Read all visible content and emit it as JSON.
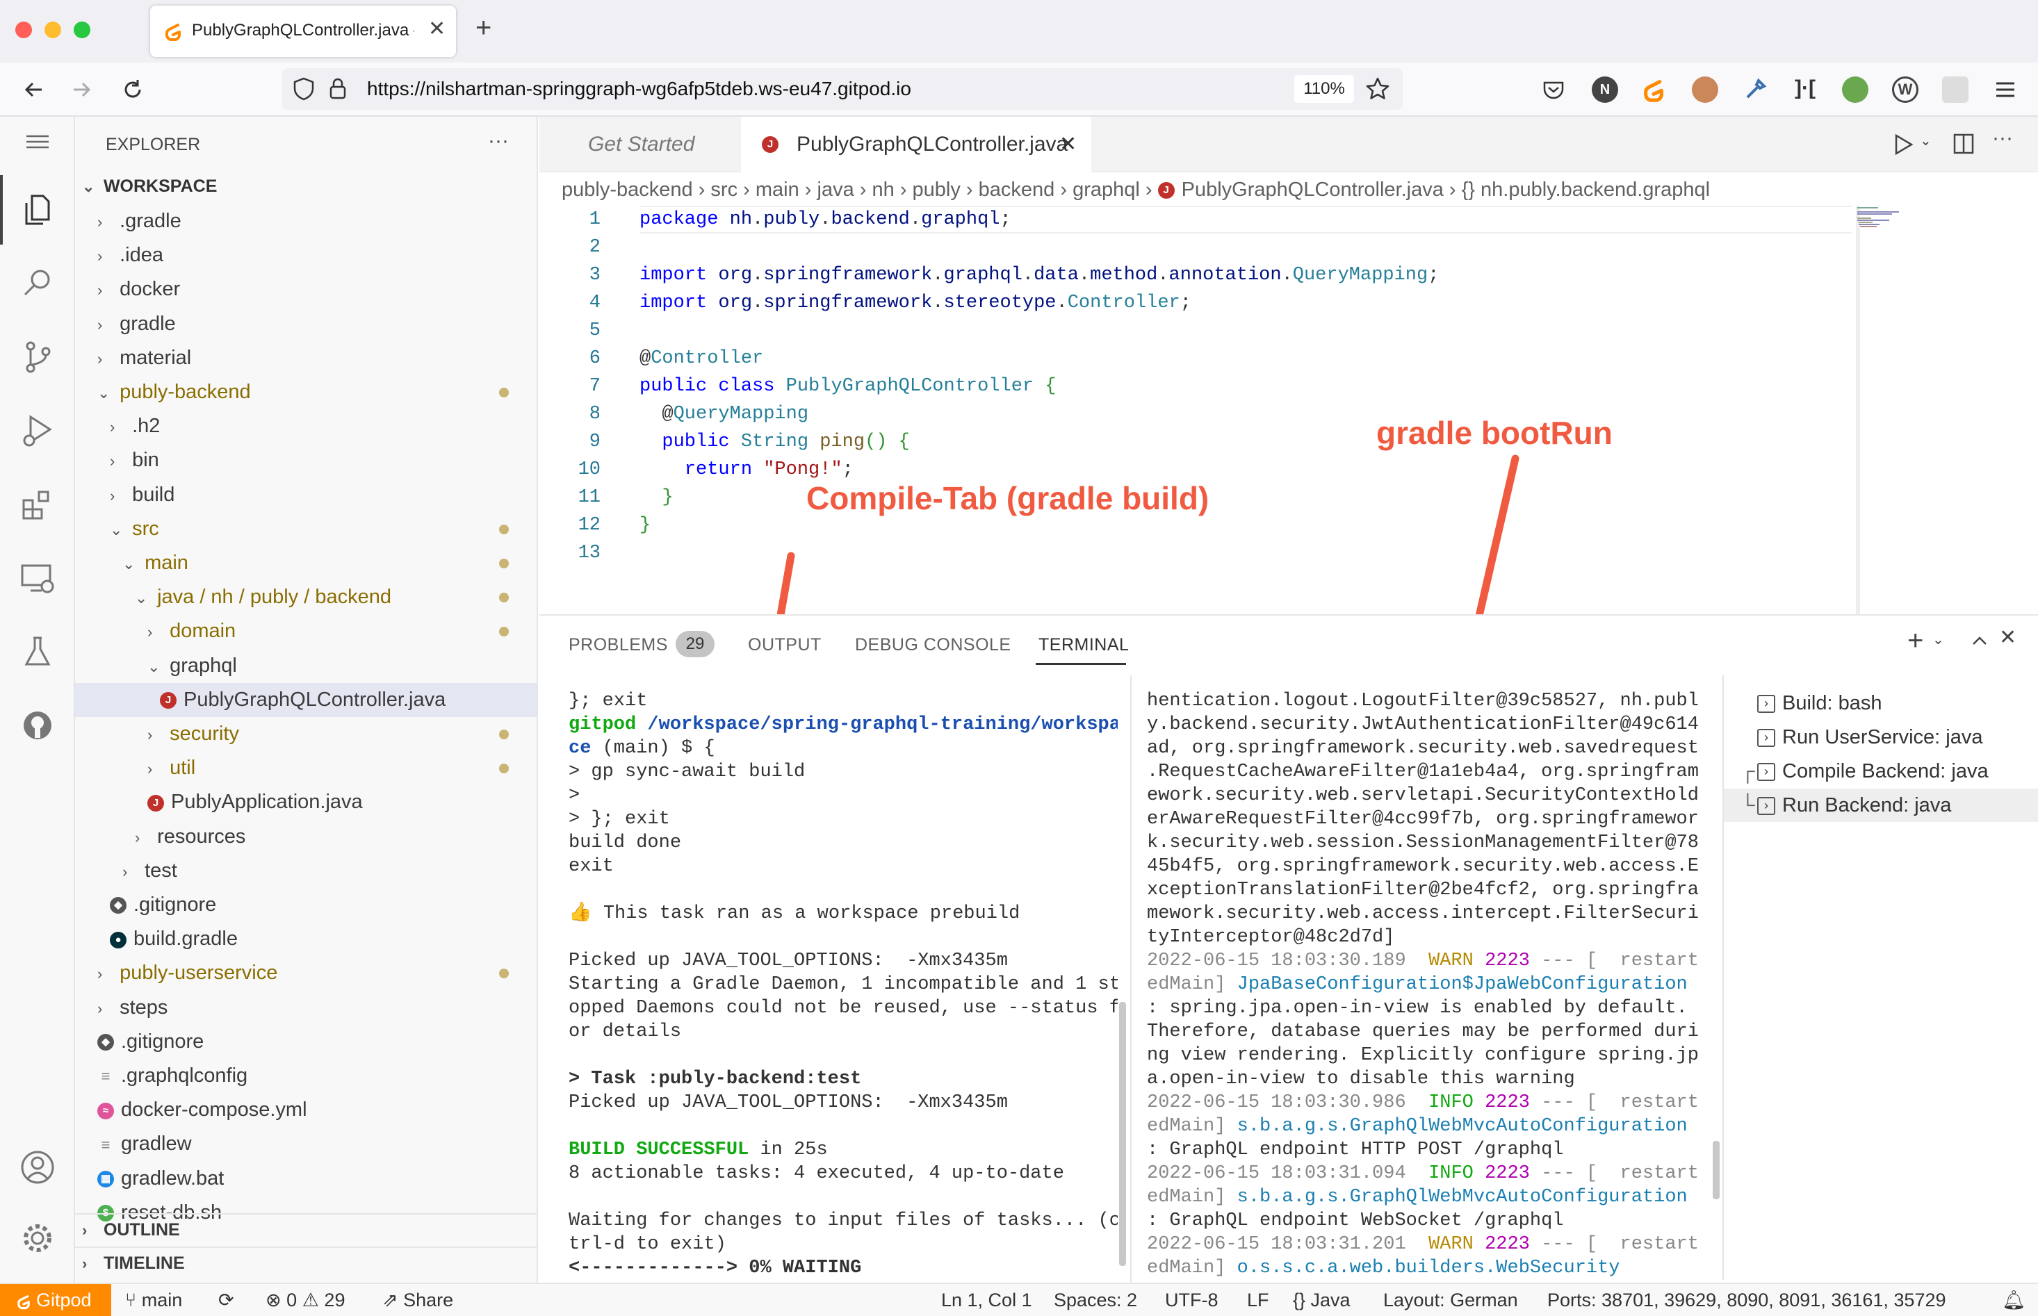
{
  "browser": {
    "tab_title": "PublyGraphQLController.java —",
    "url": "https://nilshartman-springgraph-wg6afp5tdeb.ws-eu47.gitpod.io",
    "zoom": "110%",
    "colors": {
      "close": "#ff5f57",
      "minimize": "#febc2e",
      "maximize": "#28c840"
    }
  },
  "explorer": {
    "title": "EXPLORER",
    "workspace": "WORKSPACE",
    "items": [
      {
        "label": ".gradle",
        "indent": 1,
        "kind": "folder",
        "open": false
      },
      {
        "label": ".idea",
        "indent": 1,
        "kind": "folder",
        "open": false
      },
      {
        "label": "docker",
        "indent": 1,
        "kind": "folder",
        "open": false
      },
      {
        "label": "gradle",
        "indent": 1,
        "kind": "folder",
        "open": false
      },
      {
        "label": "material",
        "indent": 1,
        "kind": "folder",
        "open": false
      },
      {
        "label": "publy-backend",
        "indent": 1,
        "kind": "folder",
        "open": true,
        "modified": true
      },
      {
        "label": ".h2",
        "indent": 2,
        "kind": "folder",
        "open": false
      },
      {
        "label": "bin",
        "indent": 2,
        "kind": "folder",
        "open": false
      },
      {
        "label": "build",
        "indent": 2,
        "kind": "folder",
        "open": false
      },
      {
        "label": "src",
        "indent": 2,
        "kind": "folder",
        "open": true,
        "modified": true
      },
      {
        "label": "main",
        "indent": 3,
        "kind": "folder",
        "open": true,
        "modified": true
      },
      {
        "label": "java / nh / publy / backend",
        "indent": 4,
        "kind": "folder",
        "open": true,
        "modified": true
      },
      {
        "label": "domain",
        "indent": 5,
        "kind": "folder",
        "open": false,
        "modified": true
      },
      {
        "label": "graphql",
        "indent": 5,
        "kind": "folder",
        "open": true
      },
      {
        "label": "PublyGraphQLController.java",
        "indent": 6,
        "kind": "java",
        "selected": true
      },
      {
        "label": "security",
        "indent": 5,
        "kind": "folder",
        "open": false,
        "modified": true
      },
      {
        "label": "util",
        "indent": 5,
        "kind": "folder",
        "open": false,
        "modified": true
      },
      {
        "label": "PublyApplication.java",
        "indent": 5,
        "kind": "java"
      },
      {
        "label": "resources",
        "indent": 4,
        "kind": "folder",
        "open": false
      },
      {
        "label": "test",
        "indent": 3,
        "kind": "folder",
        "open": false
      },
      {
        "label": ".gitignore",
        "indent": 2,
        "kind": "git"
      },
      {
        "label": "build.gradle",
        "indent": 2,
        "kind": "gradle"
      },
      {
        "label": "publy-userservice",
        "indent": 1,
        "kind": "folder",
        "open": false,
        "modified": true
      },
      {
        "label": "steps",
        "indent": 1,
        "kind": "folder",
        "open": false
      },
      {
        "label": ".gitignore",
        "indent": 1,
        "kind": "git"
      },
      {
        "label": ".graphqlconfig",
        "indent": 1,
        "kind": "text"
      },
      {
        "label": "docker-compose.yml",
        "indent": 1,
        "kind": "docker"
      },
      {
        "label": "gradlew",
        "indent": 1,
        "kind": "text"
      },
      {
        "label": "gradlew.bat",
        "indent": 1,
        "kind": "windows"
      },
      {
        "label": "reset-db.sh",
        "indent": 1,
        "kind": "shell"
      }
    ],
    "outline": "OUTLINE",
    "timeline": "TIMELINE"
  },
  "editor": {
    "tabs": [
      {
        "label": "Get Started",
        "active": false
      },
      {
        "label": "PublyGraphQLController.java",
        "active": true
      }
    ],
    "breadcrumb": [
      "publy-backend",
      "src",
      "main",
      "java",
      "nh",
      "publy",
      "backend",
      "graphql",
      "PublyGraphQLController.java",
      "{} nh.publy.backend.graphql"
    ],
    "lines": [
      [
        {
          "t": "package ",
          "c": "kw"
        },
        {
          "t": "nh",
          "c": "pk"
        },
        {
          "t": ".",
          "c": ""
        },
        {
          "t": "publy",
          "c": "pk"
        },
        {
          "t": ".",
          "c": ""
        },
        {
          "t": "backend",
          "c": "pk"
        },
        {
          "t": ".",
          "c": ""
        },
        {
          "t": "graphql",
          "c": "pk"
        },
        {
          "t": ";",
          "c": ""
        }
      ],
      [],
      [
        {
          "t": "import ",
          "c": "kw"
        },
        {
          "t": "org",
          "c": "pk"
        },
        {
          "t": ".",
          "c": ""
        },
        {
          "t": "springframework",
          "c": "pk"
        },
        {
          "t": ".",
          "c": ""
        },
        {
          "t": "graphql",
          "c": "pk"
        },
        {
          "t": ".",
          "c": ""
        },
        {
          "t": "data",
          "c": "pk"
        },
        {
          "t": ".",
          "c": ""
        },
        {
          "t": "method",
          "c": "pk"
        },
        {
          "t": ".",
          "c": ""
        },
        {
          "t": "annotation",
          "c": "pk"
        },
        {
          "t": ".",
          "c": ""
        },
        {
          "t": "QueryMapping",
          "c": "ty"
        },
        {
          "t": ";",
          "c": ""
        }
      ],
      [
        {
          "t": "import ",
          "c": "kw"
        },
        {
          "t": "org",
          "c": "pk"
        },
        {
          "t": ".",
          "c": ""
        },
        {
          "t": "springframework",
          "c": "pk"
        },
        {
          "t": ".",
          "c": ""
        },
        {
          "t": "stereotype",
          "c": "pk"
        },
        {
          "t": ".",
          "c": ""
        },
        {
          "t": "Controller",
          "c": "ty"
        },
        {
          "t": ";",
          "c": ""
        }
      ],
      [],
      [
        {
          "t": "@",
          "c": ""
        },
        {
          "t": "Controller",
          "c": "ty"
        }
      ],
      [
        {
          "t": "public class ",
          "c": "kw"
        },
        {
          "t": "PublyGraphQLController",
          "c": "ty"
        },
        {
          "t": " {",
          "c": "br"
        }
      ],
      [
        {
          "t": "  @",
          "c": ""
        },
        {
          "t": "QueryMapping",
          "c": "ty"
        }
      ],
      [
        {
          "t": "  public ",
          "c": "kw"
        },
        {
          "t": "String ",
          "c": "ty"
        },
        {
          "t": "ping",
          "c": "fn"
        },
        {
          "t": "() {",
          "c": "br"
        }
      ],
      [
        {
          "t": "    return ",
          "c": "kw"
        },
        {
          "t": "\"Pong!\"",
          "c": "st"
        },
        {
          "t": ";",
          "c": ""
        }
      ],
      [
        {
          "t": "  }",
          "c": "br"
        }
      ],
      [
        {
          "t": "}",
          "c": "br"
        }
      ],
      []
    ]
  },
  "annotations": {
    "compile": "Compile-Tab (gradle build)",
    "bootrun": "gradle bootRun"
  },
  "panel": {
    "tabs": [
      "PROBLEMS",
      "OUTPUT",
      "DEBUG CONSOLE",
      "TERMINAL"
    ],
    "problems_count": "29",
    "terminal_left": "}; exit\ngitpod /workspace/spring-graphql-training/workspa\nce (main) $ {\n> gp sync-await build\n>\n> }; exit\nbuild done\nexit\n\n👍 This task ran as a workspace prebuild\n\nPicked up JAVA_TOOL_OPTIONS:  -Xmx3435m\nStarting a Gradle Daemon, 1 incompatible and 1 st\nopped Daemons could not be reused, use --status f\nor details\n\n> Task :publy-backend:test\nPicked up JAVA_TOOL_OPTIONS:  -Xmx3435m\n\nBUILD SUCCESSFUL in 25s\n8 actionable tasks: 4 executed, 4 up-to-date\n\nWaiting for changes to input files of tasks... (c\ntrl-d to exit)\n<-------------> 0% WAITING",
    "terminal_right": "hentication.logout.LogoutFilter@39c58527, nh.publ\ny.backend.security.JwtAuthenticationFilter@49c614\nad, org.springframework.security.web.savedrequest\n.RequestCacheAwareFilter@1a1eb4a4, org.springfram\nework.security.web.servletapi.SecurityContextHold\nerAwareRequestFilter@4cc99f7b, org.springframewor\nk.security.web.session.SessionManagementFilter@78\n45b4f5, org.springframework.security.web.access.E\nxceptionTranslationFilter@2be4fcf2, org.springfra\nmework.security.web.access.intercept.FilterSecuri\ntyInterceptor@48c2d7d]\n2022-06-15 18:03:30.189  WARN 2223 --- [  restart\nedMain] JpaBaseConfiguration$JpaWebConfiguration\n: spring.jpa.open-in-view is enabled by default.\nTherefore, database queries may be performed duri\nng view rendering. Explicitly configure spring.jp\na.open-in-view to disable this warning\n2022-06-15 18:03:30.986  INFO 2223 --- [  restart\nedMain] s.b.a.g.s.GraphQlWebMvcAutoConfiguration\n: GraphQL endpoint HTTP POST /graphql\n2022-06-15 18:03:31.094  INFO 2223 --- [  restart\nedMain] s.b.a.g.s.GraphQlWebMvcAutoConfiguration\n: GraphQL endpoint WebSocket /graphql\n2022-06-15 18:03:31.201  WARN 2223 --- [  restart\nedMain] o.s.s.c.a.web.builders.WebSecurity",
    "tasks": [
      {
        "label": "Build: bash",
        "prefix": ""
      },
      {
        "label": "Run UserService: java",
        "prefix": ""
      },
      {
        "label": "Compile Backend: java",
        "prefix": "┌"
      },
      {
        "label": "Run Backend: java",
        "prefix": "└",
        "selected": true
      }
    ]
  },
  "status": {
    "gitpod": "Gitpod",
    "branch": "main",
    "errors": "0",
    "warnings": "29",
    "share": "Share",
    "position": "Ln 1, Col 1",
    "spaces": "Spaces: 2",
    "encoding": "UTF-8",
    "eol": "LF",
    "language": "{} Java",
    "layout": "Layout: German",
    "ports": "Ports: 38701, 39629, 8090, 8091, 36161, 35729",
    "accent": "#ff8a00"
  }
}
